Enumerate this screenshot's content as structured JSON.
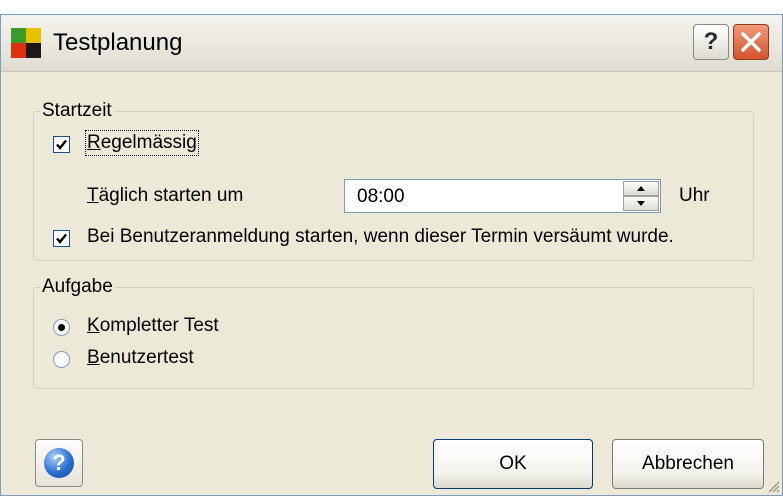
{
  "window": {
    "title": "Testplanung",
    "help_button_glyph": "?",
    "close_button_icon": "close-icon"
  },
  "startzeit": {
    "legend": "Startzeit",
    "regelmaessig": {
      "label": "Regelmässig",
      "checked": true
    },
    "taeglich_label": "Täglich starten um",
    "time_value": "08:00",
    "time_unit": "Uhr",
    "benutzeranmeldung": {
      "label": "Bei Benutzeranmeldung starten, wenn dieser Termin versäumt wurde.",
      "checked": true
    }
  },
  "aufgabe": {
    "legend": "Aufgabe",
    "options": [
      {
        "label": "Kompletter Test",
        "selected": true
      },
      {
        "label": "Benutzertest",
        "selected": false
      }
    ]
  },
  "footer": {
    "help_icon": "help-circle-icon",
    "help_glyph": "?",
    "ok_label": "OK",
    "cancel_label": "Abbrechen"
  },
  "colors": {
    "dialog_bg": "#ece9d8",
    "close_red": "#d4532c",
    "focus_border": "#003c74"
  }
}
